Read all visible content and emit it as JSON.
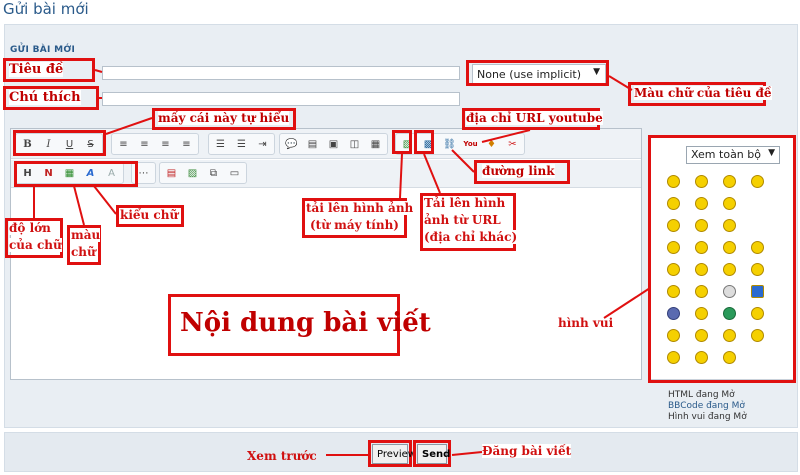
{
  "page_title": "Gửi bài mới",
  "panel_heading": "GỬI BÀI MỚI",
  "form": {
    "subject_value": "",
    "description_value": "",
    "title_color_option": "None (use implicit)"
  },
  "editor": {
    "body_text": "Nội dung bài viết"
  },
  "smilies": {
    "select_label": "Xem toàn bộ",
    "status": [
      "HTML đang Mở",
      "BBCode đang Mở",
      "Hình vui đang Mở"
    ]
  },
  "buttons": {
    "preview": "Preview",
    "send": "Send"
  },
  "annotations": {
    "subject": "Tiêu đề",
    "description": "Chú thích",
    "title_color": "Màu chữ của tiêu đề",
    "self_explanatory": "mấy cái này tự hiểu",
    "youtube_url": "địa chỉ URL youtube",
    "link": "đường link",
    "upload_image": [
      "tải lên hình ảnh",
      "(từ máy tính)"
    ],
    "upload_url": [
      "Tải lên hình",
      "ảnh từ URL",
      "(địa chỉ khác)"
    ],
    "font_size": [
      "độ lớn",
      "của chữ"
    ],
    "font_color": [
      "màu",
      "chữ"
    ],
    "font_style": "kiểu chữ",
    "smilies": "hình vui",
    "preview": "Xem trước",
    "post": "Đăng bài viết"
  },
  "colors": {
    "accent": "#e01010",
    "heading": "#2a5a8a",
    "panel": "#e9eef3"
  }
}
